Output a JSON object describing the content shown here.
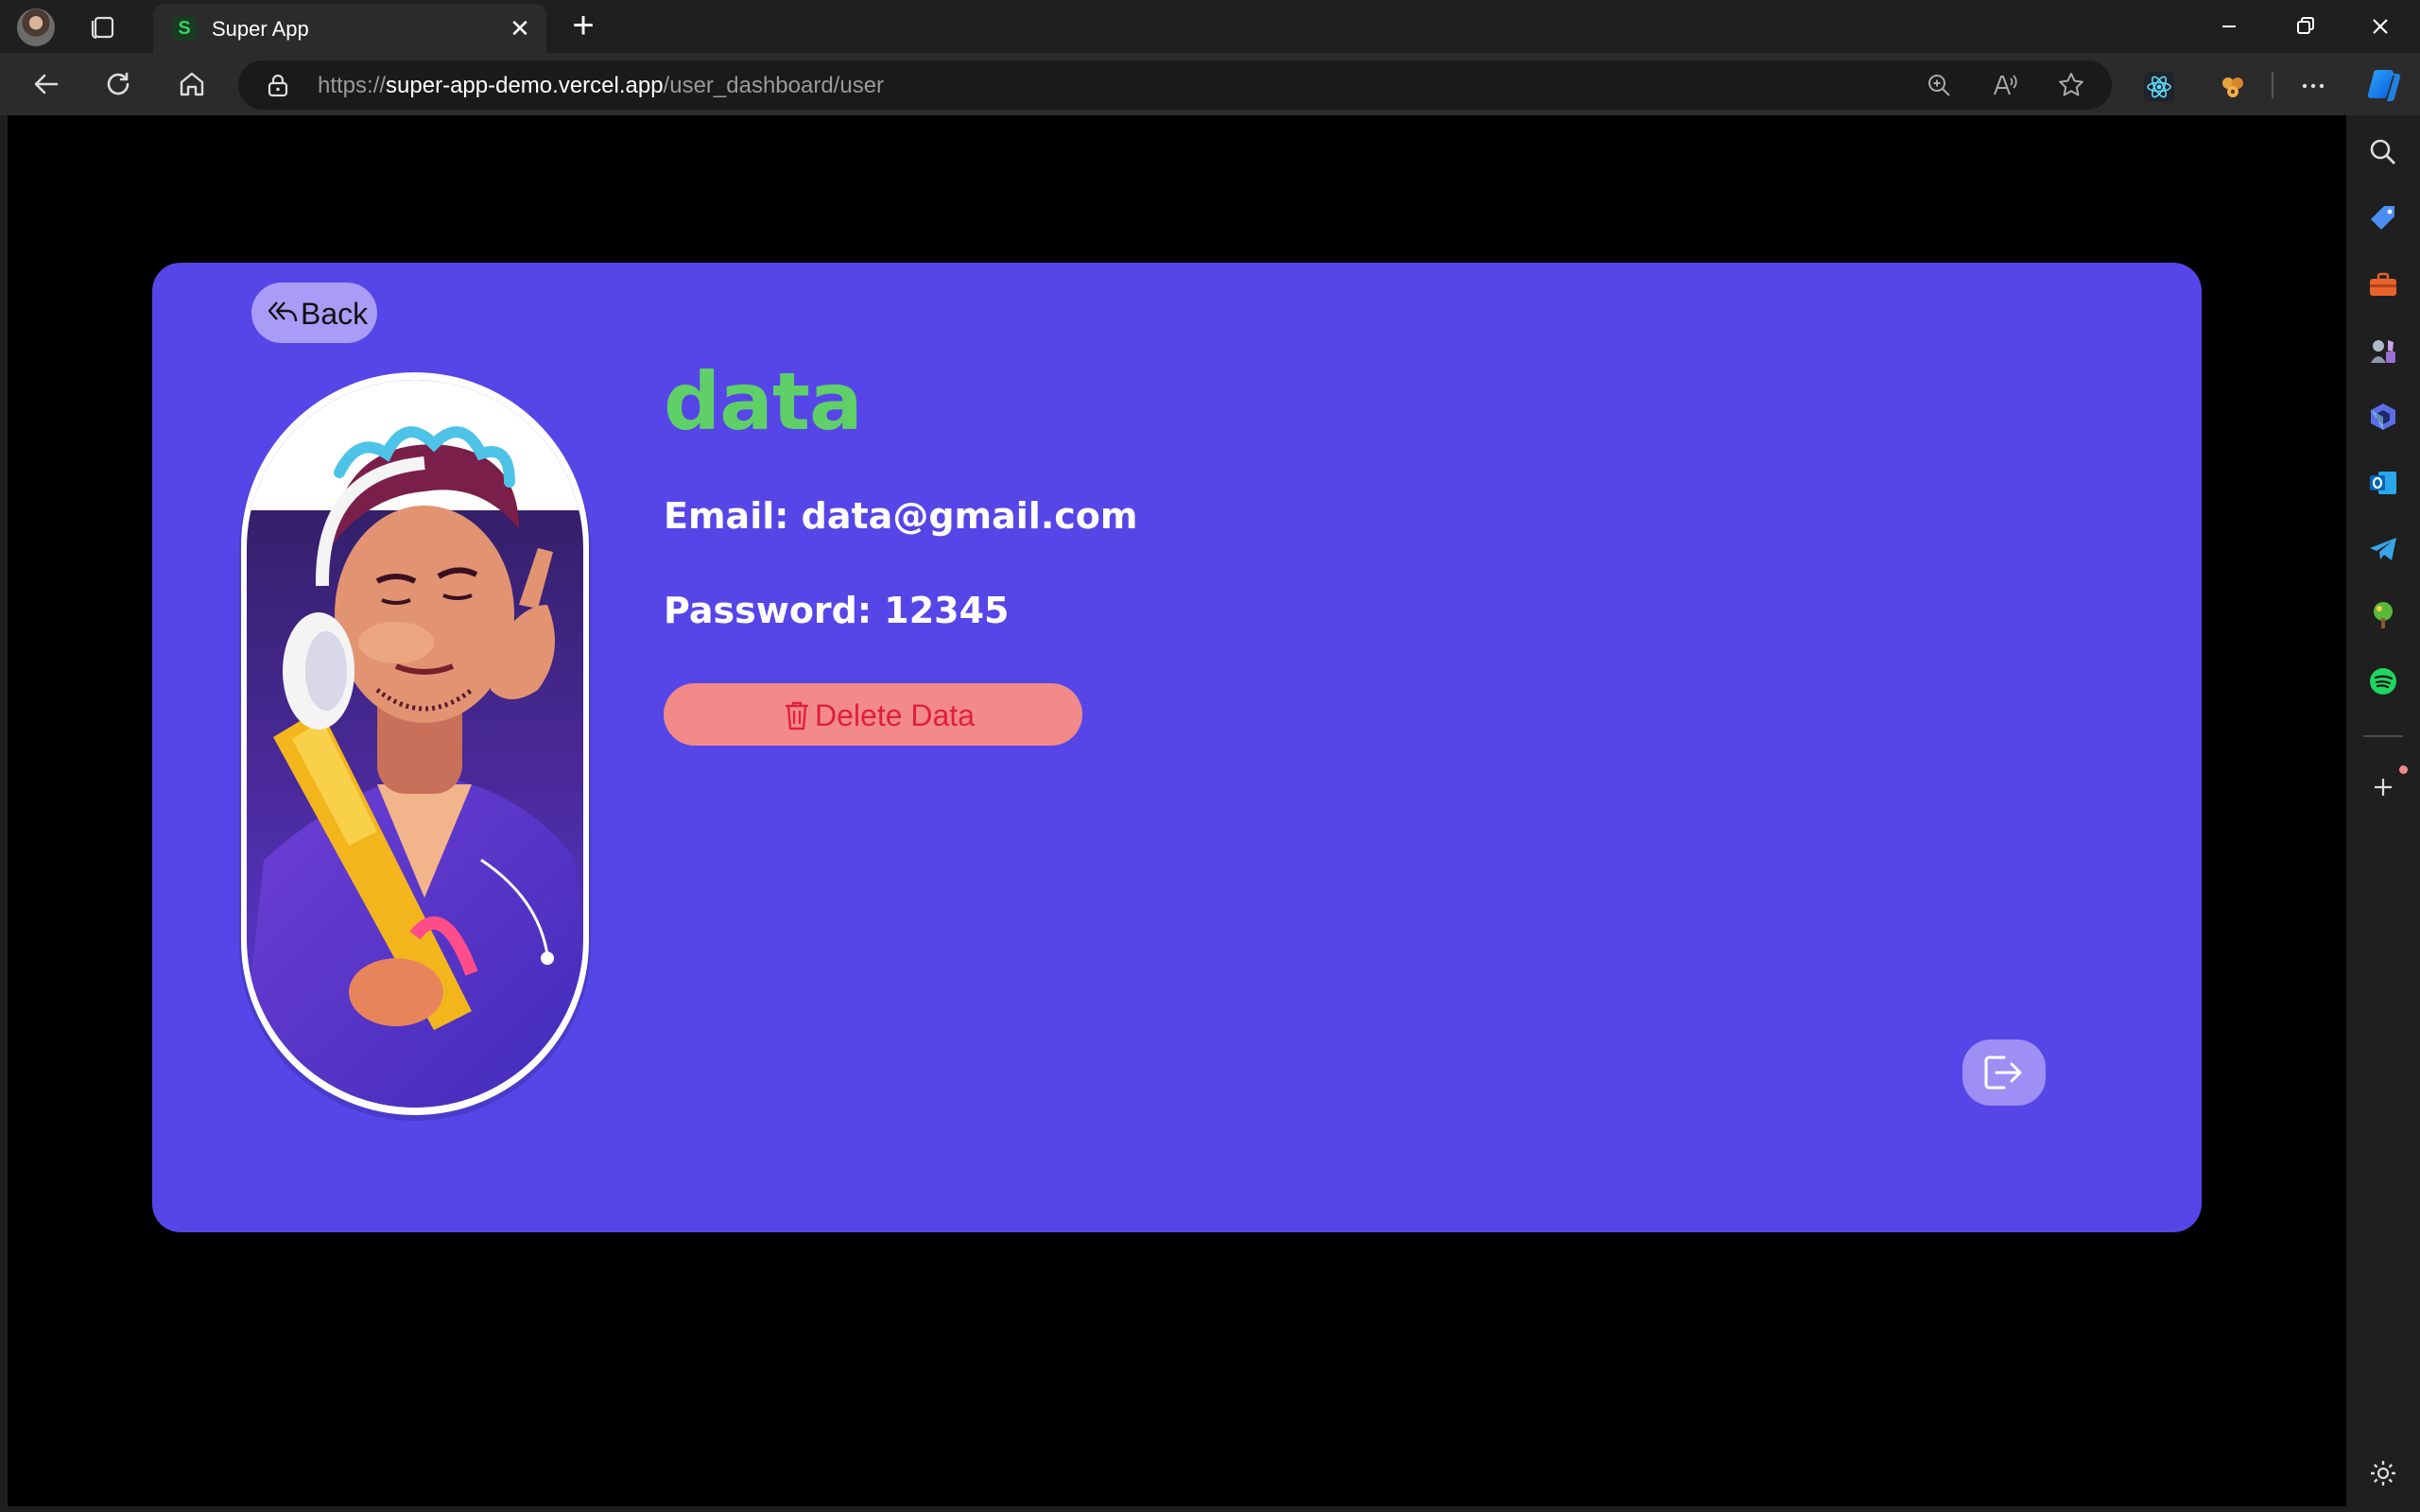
{
  "browser": {
    "tab": {
      "title": "Super App",
      "favicon_letter": "S"
    },
    "address": {
      "scheme": "https://",
      "host": "super-app-demo.vercel.app",
      "path": "/user_dashboard/user"
    },
    "toolbar_icons": [
      "back-icon",
      "refresh-icon",
      "home-icon",
      "lock-icon",
      "zoom-icon",
      "read-aloud-icon",
      "favorite-icon",
      "react-devtools-icon",
      "extension-icon",
      "more-icon",
      "copilot-icon"
    ],
    "sidebar_icons": [
      "search-icon",
      "shopping-tag-icon",
      "tools-icon",
      "games-icon",
      "microsoft-365-icon",
      "outlook-icon",
      "telegram-icon",
      "tree-icon",
      "spotify-icon",
      "add-icon",
      "settings-icon"
    ]
  },
  "page": {
    "background_color": "#000000",
    "card_color": "#5646e8",
    "back_button": {
      "label": "Back"
    },
    "user": {
      "name": "data",
      "email_line": "Email: data@gmail.com",
      "password_line": "Password: 12345"
    },
    "delete_button": {
      "label": "Delete Data"
    },
    "accent_colors": {
      "name": "#5fd068",
      "delete_bg": "#f28a8a",
      "delete_text": "#e0203a"
    }
  }
}
